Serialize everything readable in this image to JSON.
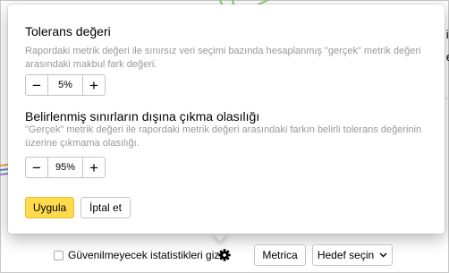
{
  "background": {
    "right_text_line1": "ir",
    "right_text_line2": "e"
  },
  "popup": {
    "tolerance": {
      "title": "Tolerans değeri",
      "description": "Rapordaki metrik değeri ile sınırsız veri seçimi bazında hesaplanmış \"gerçek\" metrik değeri arasındaki makbul fark değeri.",
      "value": "5%",
      "minus": "−",
      "plus": "+"
    },
    "probability": {
      "title": "Belirlenmiş sınırların dışına çıkma olasılığı",
      "description": "\"Gerçek\" metrik değeri ile rapordaki metrik değeri arasındaki farkın belirli tolerans değerinin üzerine çıkmama olasılığı.",
      "value": "95%",
      "minus": "−",
      "plus": "+"
    },
    "apply_label": "Uygula",
    "cancel_label": "İptal et"
  },
  "bottom_bar": {
    "checkbox_label": "Güvenilmeyecek istatistikleri gizle",
    "metrica_label": "Metrica",
    "goal_label": "Hedef seçin"
  },
  "icons": {
    "settings": "gear-icon",
    "dropdown": "chevron-down-icon"
  },
  "colors": {
    "apply_button": "#ffdb4d",
    "chart_green": "#8ccc6e",
    "chart_blue": "#5b8fd6",
    "chart_orange": "#f0a040"
  }
}
